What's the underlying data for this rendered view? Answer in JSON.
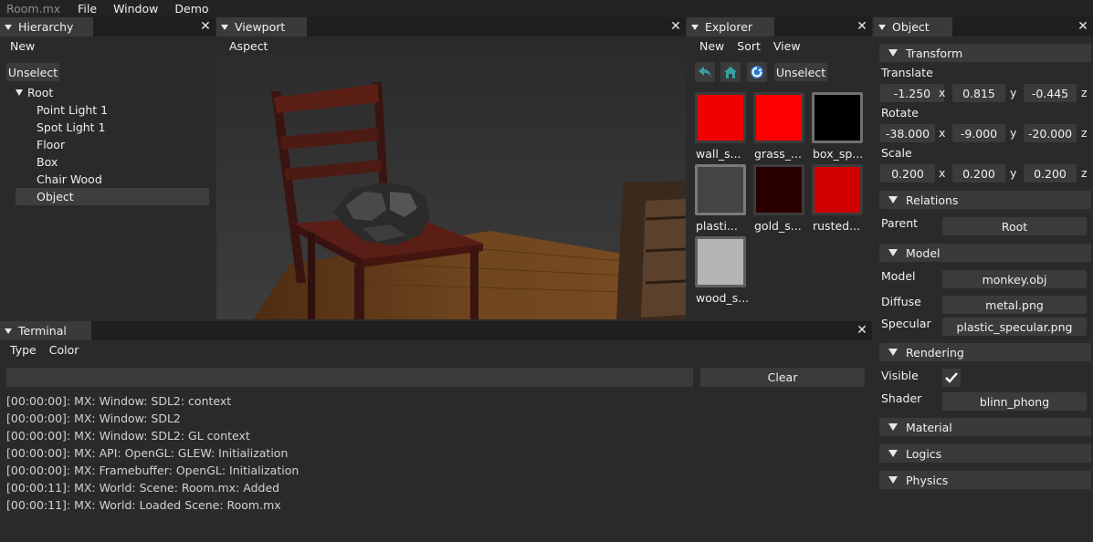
{
  "menu": {
    "title": "Room.mx",
    "items": [
      "File",
      "Window",
      "Demo"
    ]
  },
  "hierarchy": {
    "tab": "Hierarchy",
    "menu_new": "New",
    "unselect": "Unselect",
    "root": "Root",
    "items": [
      "Point Light 1",
      "Spot Light 1",
      "Floor",
      "Box",
      "Chair Wood",
      "Object"
    ],
    "selected": "Object"
  },
  "viewport": {
    "tab": "Viewport",
    "menu_aspect": "Aspect"
  },
  "explorer": {
    "tab": "Explorer",
    "menu": [
      "New",
      "Sort",
      "View"
    ],
    "unselect": "Unselect",
    "icons": [
      "back-icon",
      "home-icon",
      "refresh-icon"
    ],
    "items": [
      {
        "label": "wall_s...",
        "color": "#f20000"
      },
      {
        "label": "grass_...",
        "color": "#ff0000"
      },
      {
        "label": "box_sp...",
        "color": "#000000"
      },
      {
        "label": "plasti...",
        "color": "#444444"
      },
      {
        "label": "gold_s...",
        "color": "#2a0000"
      },
      {
        "label": "rusted...",
        "color": "#d10000"
      },
      {
        "label": "wood_s...",
        "color": "#b5b5b5"
      }
    ]
  },
  "terminal": {
    "tab": "Terminal",
    "menu": [
      "Type",
      "Color"
    ],
    "input_value": "",
    "clear": "Clear",
    "lines": [
      "[00:00:00]: MX: Window: SDL2: context",
      "[00:00:00]: MX: Window: SDL2",
      "[00:00:00]: MX: Window: SDL2: GL context",
      "[00:00:00]: MX: API: OpenGL: GLEW: Initialization",
      "[00:00:00]: MX: Framebuffer: OpenGL: Initialization",
      "[00:00:11]: MX: World: Scene: Room.mx: Added",
      "[00:00:11]: MX: World: Loaded Scene: Room.mx"
    ]
  },
  "object": {
    "tab": "Object",
    "sections": {
      "transform": "Transform",
      "relations": "Relations",
      "model": "Model",
      "rendering": "Rendering",
      "material": "Material",
      "logics": "Logics",
      "physics": "Physics"
    },
    "axes": [
      "x",
      "y",
      "z"
    ],
    "translate_label": "Translate",
    "translate": [
      "-1.250",
      "0.815",
      "-0.445"
    ],
    "rotate_label": "Rotate",
    "rotate": [
      "-38.000",
      "-9.000",
      "-20.000"
    ],
    "scale_label": "Scale",
    "scale": [
      "0.200",
      "0.200",
      "0.200"
    ],
    "parent_label": "Parent",
    "parent": "Root",
    "model_label": "Model",
    "model": "monkey.obj",
    "diffuse_label": "Diffuse",
    "diffuse": "metal.png",
    "specular_label": "Specular",
    "specular": "plastic_specular.png",
    "visible_label": "Visible",
    "visible": true,
    "shader_label": "Shader",
    "shader": "blinn_phong"
  }
}
